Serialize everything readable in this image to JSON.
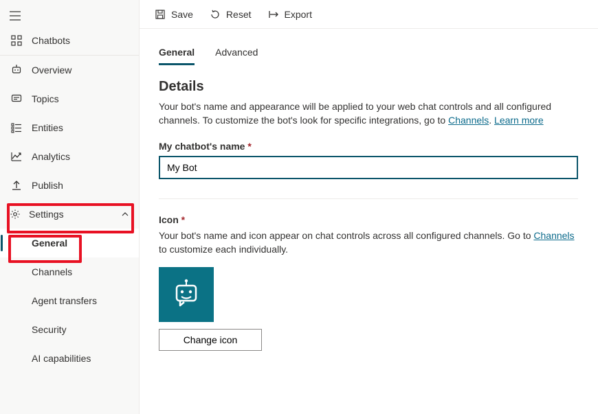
{
  "sidebar": {
    "chatbots_label": "Chatbots",
    "items": [
      {
        "label": "Overview"
      },
      {
        "label": "Topics"
      },
      {
        "label": "Entities"
      },
      {
        "label": "Analytics"
      },
      {
        "label": "Publish"
      }
    ],
    "settings_label": "Settings",
    "subitems": [
      {
        "label": "General"
      },
      {
        "label": "Channels"
      },
      {
        "label": "Agent transfers"
      },
      {
        "label": "Security"
      },
      {
        "label": "AI capabilities"
      }
    ]
  },
  "cmdbar": {
    "save": "Save",
    "reset": "Reset",
    "export": "Export"
  },
  "tabs": {
    "general": "General",
    "advanced": "Advanced"
  },
  "details": {
    "title": "Details",
    "desc_prefix": "Your bot's name and appearance will be applied to your web chat controls and all configured channels. To customize the bot's look for specific integrations, go to ",
    "channels_link": "Channels",
    "learn_more": "Learn more",
    "name_field_label": "My chatbot's name",
    "name_field_value": "My Bot",
    "icon_label": "Icon",
    "icon_desc_prefix": "Your bot's name and icon appear on chat controls across all configured channels. Go to ",
    "icon_desc_suffix": " to customize each individually.",
    "change_icon": "Change icon"
  }
}
